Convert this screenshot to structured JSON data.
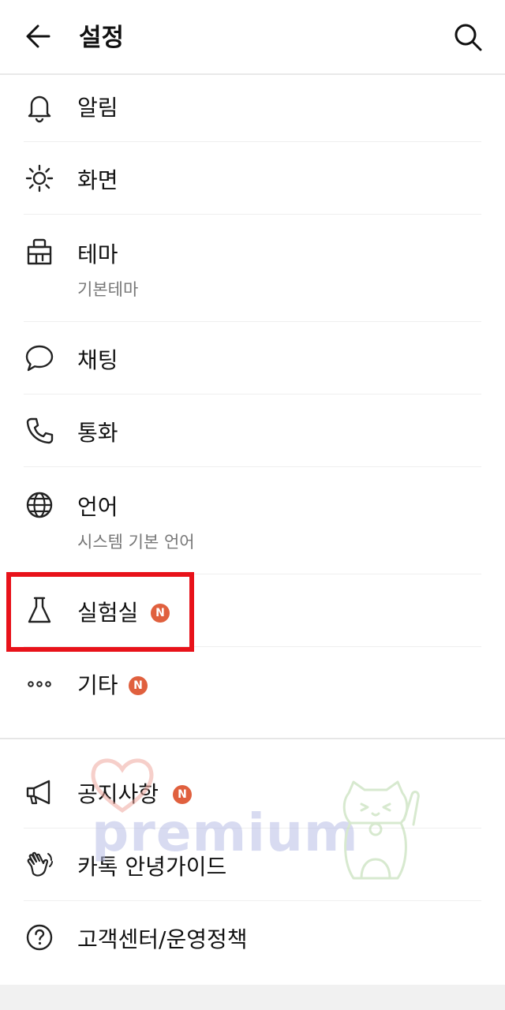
{
  "header": {
    "title": "설정"
  },
  "menu": [
    {
      "label": "알림",
      "icon": "bell-icon"
    },
    {
      "label": "화면",
      "icon": "brightness-icon"
    },
    {
      "label": "테마",
      "sub": "기본테마",
      "icon": "paint-brush-icon"
    },
    {
      "label": "채팅",
      "icon": "chat-bubble-icon"
    },
    {
      "label": "통화",
      "icon": "phone-icon"
    },
    {
      "label": "언어",
      "sub": "시스템 기본 언어",
      "icon": "globe-icon"
    },
    {
      "label": "실험실",
      "badge": "N",
      "icon": "flask-icon"
    },
    {
      "label": "기타",
      "badge": "N",
      "icon": "more-dots-icon"
    }
  ],
  "support": [
    {
      "label": "공지사항",
      "badge": "N",
      "icon": "megaphone-icon"
    },
    {
      "label": "카톡 안녕가이드",
      "icon": "waving-hand-icon"
    },
    {
      "label": "고객센터/운영정책",
      "icon": "question-circle-icon"
    }
  ],
  "watermark": {
    "text": "premium"
  },
  "colors": {
    "badge": "#e0603e",
    "highlight": "#e8121a"
  }
}
